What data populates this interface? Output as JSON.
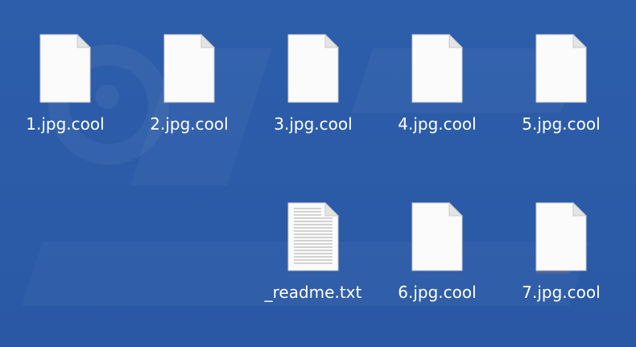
{
  "desktop": {
    "background_color": "#2b5ba8",
    "files": [
      {
        "name": "1.jpg.cool",
        "icon": "blank-document-icon"
      },
      {
        "name": "2.jpg.cool",
        "icon": "blank-document-icon"
      },
      {
        "name": "3.jpg.cool",
        "icon": "blank-document-icon"
      },
      {
        "name": "4.jpg.cool",
        "icon": "blank-document-icon"
      },
      {
        "name": "5.jpg.cool",
        "icon": "blank-document-icon"
      },
      {
        "name": "_readme.txt",
        "icon": "text-document-icon"
      },
      {
        "name": "6.jpg.cool",
        "icon": "blank-document-icon"
      },
      {
        "name": "7.jpg.cool",
        "icon": "blank-document-icon"
      }
    ]
  }
}
